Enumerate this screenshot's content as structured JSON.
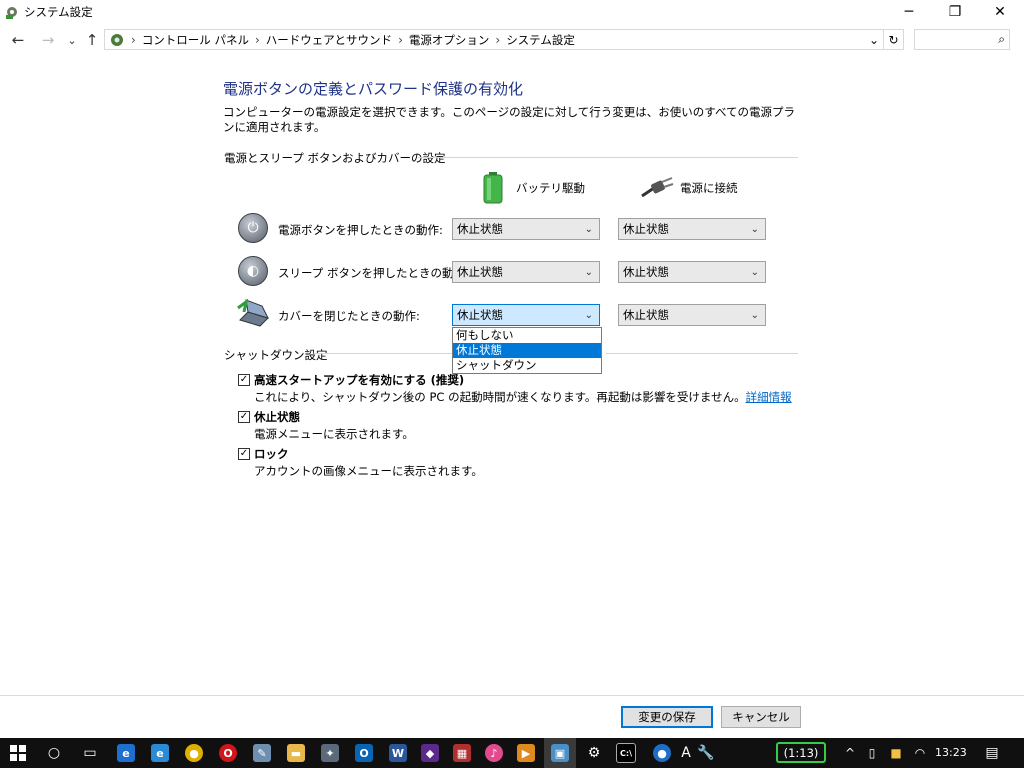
{
  "window": {
    "title": "システム設定",
    "controls": {
      "minimize": "─",
      "maximize": "❐",
      "close": "✕"
    }
  },
  "nav": {
    "back": "←",
    "forward": "→",
    "recent": "⌄",
    "up": "↑",
    "breadcrumbs": [
      "コントロール パネル",
      "ハードウェアとサウンド",
      "電源オプション",
      "システム設定"
    ],
    "separator": "›",
    "dropdown_chevron": "⌄",
    "refresh": "↻",
    "search_icon": "⌕",
    "search_placeholder": ""
  },
  "page": {
    "heading": "電源ボタンの定義とパスワード保護の有効化",
    "description": "コンピューターの電源設定を選択できます。このページの設定に対して行う変更は、お使いのすべての電源プランに適用されます。"
  },
  "power_section": {
    "title": "電源とスリープ ボタンおよびカバーの設定",
    "columns": {
      "battery": "バッテリ駆動",
      "plugged": "電源に接続"
    },
    "rows": [
      {
        "label": "電源ボタンを押したときの動作:",
        "battery": "休止状態",
        "plugged": "休止状態",
        "icon": "power-button-icon"
      },
      {
        "label": "スリープ ボタンを押したときの動作:",
        "battery": "休止状態",
        "plugged": "休止状態",
        "icon": "sleep-button-icon"
      },
      {
        "label": "カバーを閉じたときの動作:",
        "battery": "休止状態",
        "plugged": "休止状態",
        "icon": "laptop-lid-icon"
      }
    ],
    "dropdown_open": {
      "options": [
        "何もしない",
        "休止状態",
        "シャットダウン"
      ],
      "selected": "休止状態"
    }
  },
  "shutdown_section": {
    "title": "シャットダウン設定",
    "items": [
      {
        "label": "高速スタートアップを有効にする (推奨)",
        "desc": "これにより、シャットダウン後の PC の起動時間が速くなります。再起動は影響を受けません。",
        "link": "詳細情報",
        "checked": true
      },
      {
        "label": "休止状態",
        "desc": "電源メニューに表示されます。",
        "checked": true
      },
      {
        "label": "ロック",
        "desc": "アカウントの画像メニューに表示されます。",
        "checked": true
      }
    ]
  },
  "buttons": {
    "save": "変更の保存",
    "cancel": "キャンセル"
  },
  "taskbar": {
    "battery_badge": "(1:13)",
    "clock": "13:23",
    "apps": [
      "start",
      "search",
      "task-view",
      "edge",
      "internet-explorer",
      "chrome",
      "opera",
      "paint",
      "explorer",
      "utility",
      "outlook",
      "word",
      "game",
      "archive",
      "itunes",
      "media-player",
      "control-panel",
      "settings",
      "cmd",
      "app-globe",
      "font",
      "tools"
    ]
  },
  "colors": {
    "heading": "#1e3287",
    "accent": "#0078d7",
    "link": "#0066cc",
    "taskbar": "#101010",
    "battery_badge": "#3cc94a"
  }
}
